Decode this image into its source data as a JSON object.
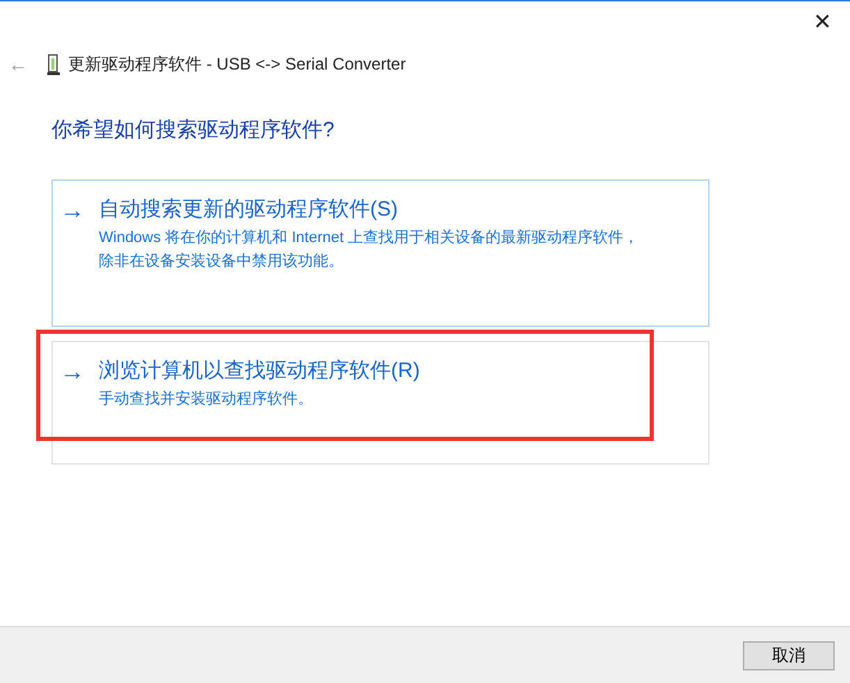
{
  "window": {
    "title": "更新驱动程序软件 - USB <-> Serial Converter",
    "close": "✕",
    "back": "←"
  },
  "heading": "你希望如何搜索驱动程序软件?",
  "options": [
    {
      "arrow": "→",
      "title": "自动搜索更新的驱动程序软件(S)",
      "description": "Windows 将在你的计算机和 Internet 上查找用于相关设备的最新驱动程序软件，除非在设备安装设备中禁用该功能。",
      "focused": true,
      "highlighted": false
    },
    {
      "arrow": "→",
      "title": "浏览计算机以查找驱动程序软件(R)",
      "description": "手动查找并安装驱动程序软件。",
      "focused": false,
      "highlighted": true
    }
  ],
  "buttons": [
    "取消"
  ]
}
